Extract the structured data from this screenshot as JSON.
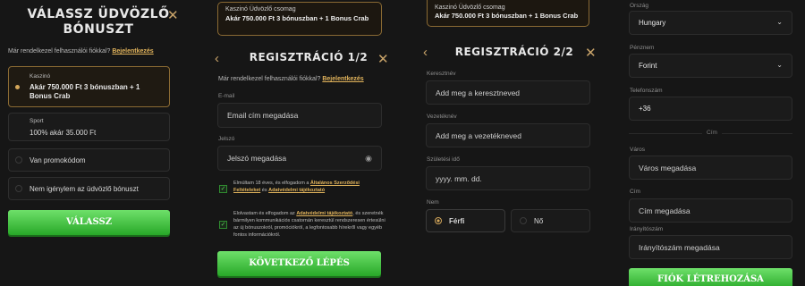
{
  "screen1": {
    "title_line1": "VÁLASSZ ÜDVÖZLŐ",
    "title_line2": "BÓNUSZT",
    "close": "✕",
    "have_account": "Már rendelkezel felhasználói fiókkal?",
    "login_link": "Bejelentkezés",
    "options": [
      {
        "category": "Kaszinó",
        "text": "Akár 750.000 Ft 3 bónuszban + 1 Bonus Crab"
      },
      {
        "category": "Sport",
        "text": "100% akár 35.000 Ft"
      },
      {
        "category": "",
        "text": "Van promokódom"
      },
      {
        "category": "",
        "text": "Nem igénylem az üdvözlő bónuszt"
      }
    ],
    "submit": "VÁLASSZ"
  },
  "screen2": {
    "package_label": "Kaszinó Üdvözlő csomag",
    "package_text": "Akár 750.000 Ft 3 bónuszban + 1 Bonus Crab",
    "title": "REGISZTRÁCIÓ 1/2",
    "have_account": "Már rendelkezel felhasználói fiókkal?",
    "login_link": "Bejelentkezés",
    "email_label": "E-mail",
    "email_placeholder": "Email cím megadása",
    "password_label": "Jelszó",
    "password_placeholder": "Jelszó megadása",
    "consent1_pre": "Elmúltam 18 éves, és elfogadom a",
    "consent1_link1": "Általános Szerződési Feltételeket",
    "consent1_mid": "és",
    "consent1_link2": "Adatvédelmi tájékoztató",
    "consent2_pre": "Elolvastam és elfogadom az",
    "consent2_link": "Adatvédelmi tájékoztató",
    "consent2_rest": ", és szeretnék bármilyen kommunikációs csatornán keresztül rendszeresen értesülni az új bónuszokról, promóciókról, a legfontosabb hírekről vagy egyéb fontos információkról.",
    "next": "KÖVETKEZŐ LÉPÉS"
  },
  "screen3": {
    "package_label": "Kaszinó Üdvözlő csomag",
    "package_text": "Akár 750.000 Ft 3 bónuszban + 1 Bonus Crab",
    "title": "REGISZTRÁCIÓ 2/2",
    "firstname_label": "Keresztnév",
    "firstname_placeholder": "Add meg a keresztneved",
    "lastname_label": "Vezetéknév",
    "lastname_placeholder": "Add meg a vezetékneved",
    "birth_label": "Születési idő",
    "birth_placeholder": "yyyy. mm. dd.",
    "gender_label": "Nem",
    "male": "Férfi",
    "female": "Nő"
  },
  "screen4": {
    "country_label": "Ország",
    "country_value": "Hungary",
    "currency_label": "Pénznem",
    "currency_value": "Forint",
    "phone_label": "Telefonszám",
    "phone_value": "+36",
    "address_divider": "Cím",
    "city_label": "Város",
    "city_placeholder": "Város megadása",
    "address_label": "Cím",
    "address_placeholder": "Cím megadása",
    "zip_label": "Irányítószám",
    "zip_placeholder": "Irányítószám megadása",
    "submit": "FIÓK LÉTREHOZÁSA"
  },
  "colors": {
    "accent_gold": "#d4a75a",
    "button_green": "#3cc23c"
  }
}
